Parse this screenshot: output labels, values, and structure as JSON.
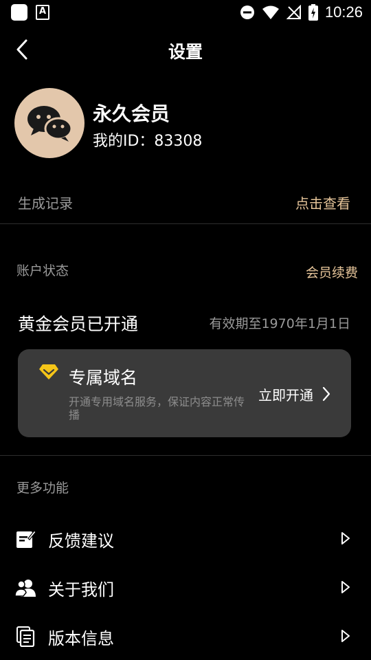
{
  "status_bar": {
    "time": "10:26"
  },
  "header": {
    "title": "设置"
  },
  "profile": {
    "membership": "永久会员",
    "user_id": "我的ID：83308"
  },
  "records": {
    "label": "生成记录",
    "action": "点击查看"
  },
  "account": {
    "section_label": "账户状态",
    "renew_action": "会员续费",
    "status": "黄金会员已开通",
    "expiry": "有效期至1970年1月1日"
  },
  "domain_card": {
    "title": "专属域名",
    "description": "开通专用域名服务，保证内容正常传播",
    "action": "立即开通"
  },
  "more": {
    "section_label": "更多功能",
    "items": [
      {
        "label": "反馈建议",
        "icon": "feedback-icon"
      },
      {
        "label": "关于我们",
        "icon": "users-icon"
      },
      {
        "label": "版本信息",
        "icon": "document-icon"
      }
    ]
  },
  "colors": {
    "accent_gold": "#e6c59a",
    "avatar_bg": "#e3c7ab",
    "card_bg": "#3a3a3a",
    "diamond": "#f5c518"
  }
}
